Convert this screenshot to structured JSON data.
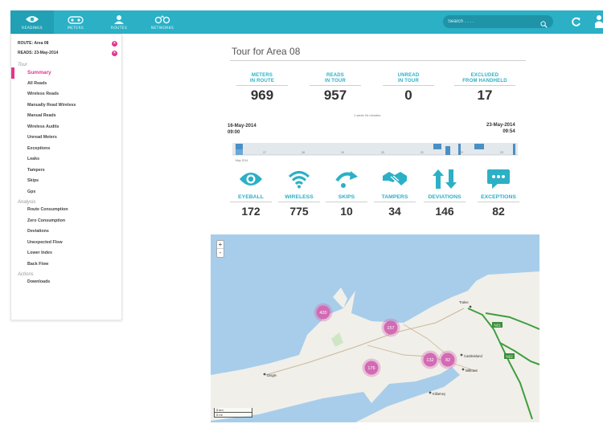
{
  "nav": {
    "items": [
      {
        "label": "READINGS",
        "icon": "eye-icon"
      },
      {
        "label": "METERS",
        "icon": "meter-icon"
      },
      {
        "label": "ROUTES",
        "icon": "route-icon"
      },
      {
        "label": "NETWORKS",
        "icon": "network-icon"
      }
    ],
    "search_placeholder": "Search . . . ."
  },
  "sidebar": {
    "filters": [
      {
        "label": "ROUTE: Area 08"
      },
      {
        "label": "READS: 23-May-2014"
      }
    ],
    "tour_section": "Tour",
    "tour_items": [
      "Summary",
      "All Reads",
      "Wireless Reads",
      "Manually Read Wireless",
      "Manual Reads",
      "Wireless Audits",
      "Unread Meters",
      "Exceptions",
      "Leaks",
      "Tampers",
      "Skips",
      "Gps"
    ],
    "analysis_section": "Analysis",
    "analysis_items": [
      "Route Consumption",
      "Zero Consumption",
      "Deviations",
      "Unexpected Flow",
      "Lower Index",
      "Back Flow"
    ],
    "actions_section": "Actions",
    "actions_items": [
      "Downloads"
    ]
  },
  "main": {
    "title": "Tour for Area 08",
    "stats": [
      {
        "label1": "METERS",
        "label2": "IN ROUTE",
        "value": "969"
      },
      {
        "label1": "READS",
        "label2": "IN TOUR",
        "value": "957"
      },
      {
        "label1": "UNREAD",
        "label2": "IN TOUR",
        "value": "0"
      },
      {
        "label1": "EXCLUDED",
        "label2": "FROM HANDHELD",
        "value": "17"
      }
    ],
    "note": "1 week 04 minutes",
    "date_start": "16-May-2014",
    "time_start": "09:00",
    "date_end": "23-May-2014",
    "time_end": "09:54",
    "timeline_ticks": [
      "17",
      "18",
      "19",
      "20",
      "21",
      "22",
      "23"
    ],
    "timeline_label": "May 2014",
    "metrics": [
      {
        "label": "EYEBALL",
        "value": "172",
        "icon": "eye-icon"
      },
      {
        "label": "WIRELESS",
        "value": "775",
        "icon": "wifi-icon"
      },
      {
        "label": "SKIPS",
        "value": "10",
        "icon": "skip-icon"
      },
      {
        "label": "TAMPERS",
        "value": "34",
        "icon": "handshake-icon"
      },
      {
        "label": "DEVIATIONS",
        "value": "146",
        "icon": "deviation-icon"
      },
      {
        "label": "EXCEPTIONS",
        "value": "82",
        "icon": "message-icon"
      }
    ]
  },
  "map": {
    "zoom_in": "+",
    "zoom_out": "-",
    "clusters": [
      "420",
      "157",
      "176",
      "132",
      "82"
    ],
    "towns": [
      "Tralee",
      "Castleisland",
      "Killarney",
      "Dingle",
      "Milltown"
    ],
    "road_labels": [
      "N21",
      "N22"
    ],
    "scale_km": "5 km",
    "scale_mi": "5 mi"
  },
  "colors": {
    "accent": "#2bb0c6",
    "highlight": "#e4348f",
    "cluster": "#d36ab4"
  }
}
